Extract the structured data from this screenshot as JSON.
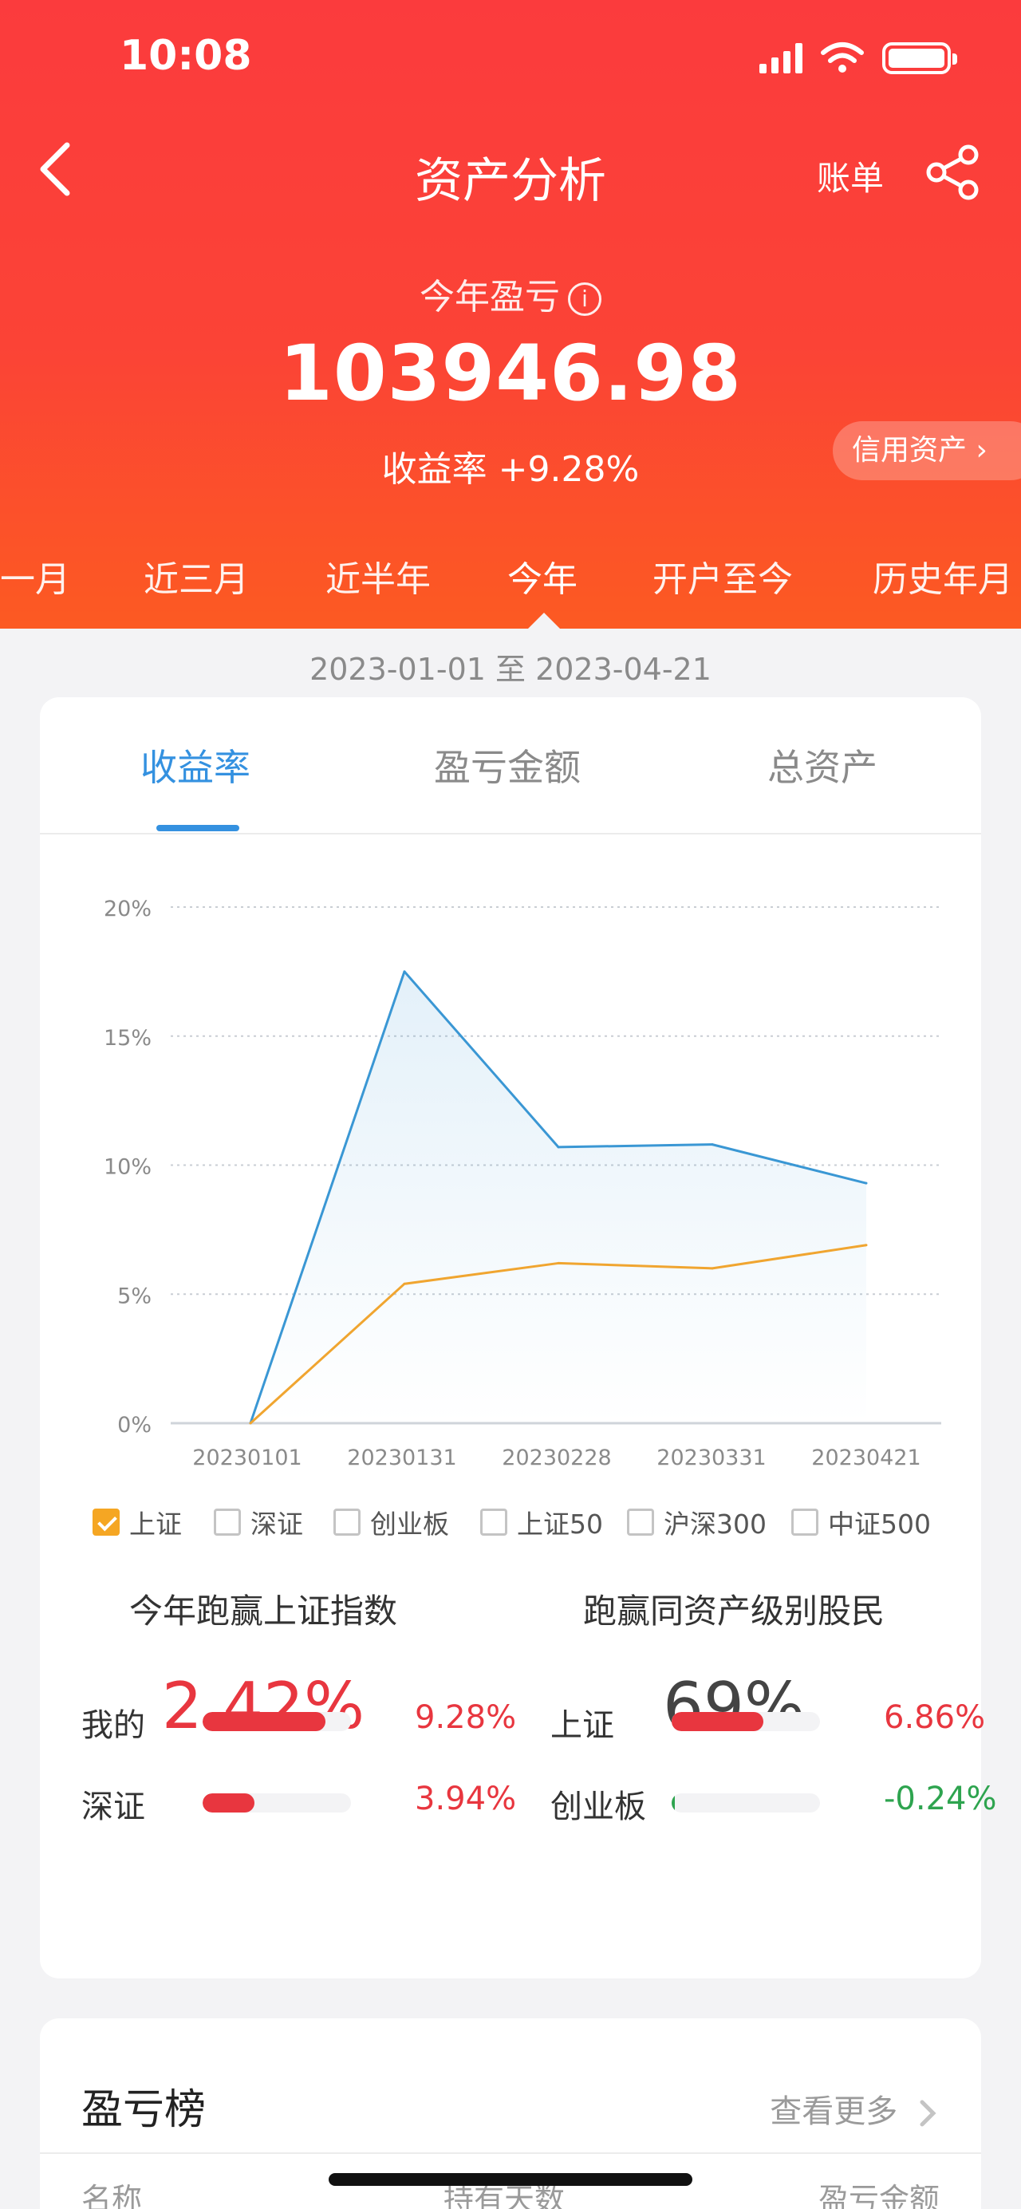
{
  "status_bar": {
    "time": "10:08"
  },
  "nav": {
    "title": "资产分析",
    "bill_label": "账单"
  },
  "summary": {
    "pl_label": "今年盈亏",
    "pl_value": "103946.98",
    "rate_label": "收益率 +9.28%",
    "credit_label": "信用资产",
    "credit_chevron": "›"
  },
  "period_tabs": [
    "一月",
    "近三月",
    "近半年",
    "今年",
    "开户至今",
    "历史年月"
  ],
  "period_selected": "今年",
  "date_range": "2023-01-01 至 2023-04-21",
  "metric_tabs": [
    "收益率",
    "盈亏金额",
    "总资产"
  ],
  "metric_selected": "收益率",
  "chart_data": {
    "type": "line",
    "x": [
      "20230101",
      "20230131",
      "20230228",
      "20230331",
      "20230421"
    ],
    "y_ticks": [
      "0%",
      "5%",
      "10%",
      "15%",
      "20%"
    ],
    "ylim": [
      0,
      20
    ],
    "grid": true,
    "series": [
      {
        "values": [
          0,
          17.5,
          10.7,
          10.8,
          9.3
        ],
        "color": "#3a97d4"
      },
      {
        "name": "上证",
        "values": [
          0,
          5.4,
          6.2,
          6.0,
          6.9
        ],
        "color": "#f0a530"
      }
    ]
  },
  "benchmarks": [
    {
      "label": "上证",
      "checked": true
    },
    {
      "label": "深证",
      "checked": false
    },
    {
      "label": "创业板",
      "checked": false
    },
    {
      "label": "上证50",
      "checked": false
    },
    {
      "label": "沪深300",
      "checked": false
    },
    {
      "label": "中证500",
      "checked": false
    }
  ],
  "beat": {
    "index_title": "今年跑赢上证指数",
    "index_value": "2.42%",
    "peers_title": "跑赢同资产级别股民",
    "peers_value": "69%"
  },
  "comparisons": [
    {
      "label": "我的",
      "value": "9.28%",
      "fraction": 0.83,
      "color": "#e8363f"
    },
    {
      "label": "上证",
      "value": "6.86%",
      "fraction": 0.62,
      "color": "#e8363f"
    },
    {
      "label": "深证",
      "value": "3.94%",
      "fraction": 0.35,
      "color": "#e8363f"
    },
    {
      "label": "创业板",
      "value": "-0.24%",
      "fraction": 0.02,
      "color": "#2ea44f"
    }
  ],
  "ranking": {
    "title": "盈亏榜",
    "more_label": "查看更多",
    "columns": [
      "名称",
      "持有天数",
      "盈亏金额"
    ]
  },
  "colors": {
    "accent_blue": "#3491e0",
    "up_red": "#e8363f",
    "down_green": "#2ea44f",
    "header_red": "#fb3b3d"
  }
}
